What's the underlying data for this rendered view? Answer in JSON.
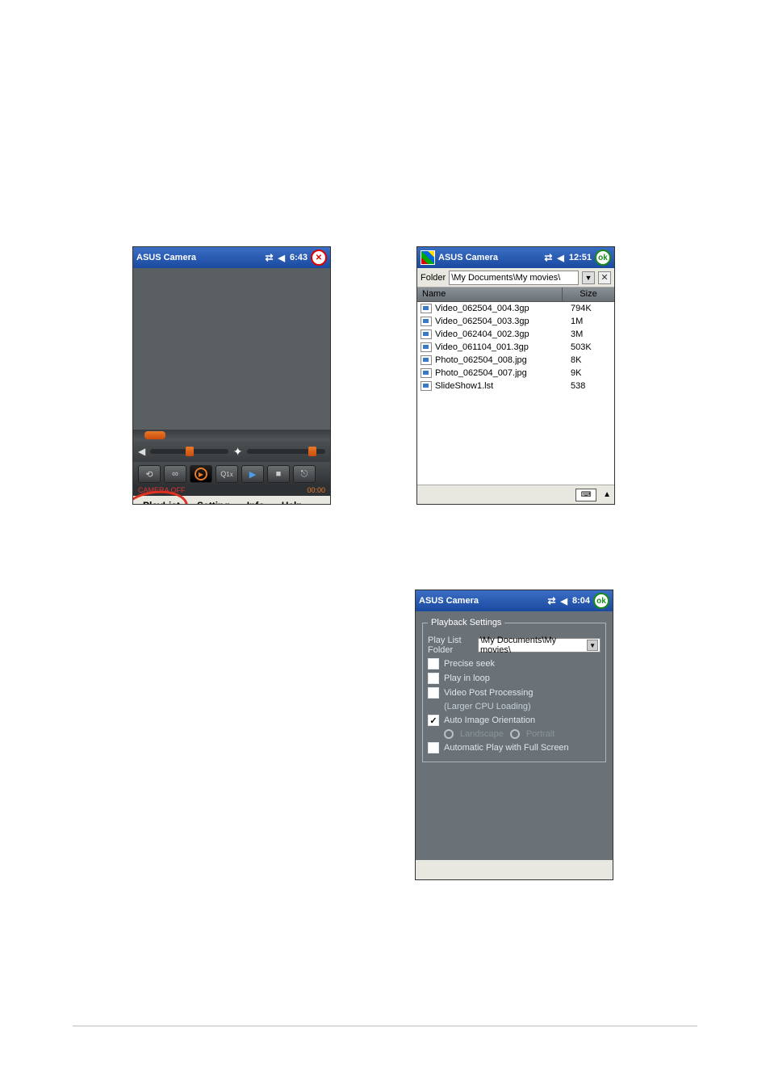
{
  "app_title": "ASUS Camera",
  "screen1": {
    "time": "6:43",
    "status_left": "CAMERA OFF",
    "status_right": "00:00",
    "zoom_label": "1x",
    "menu": {
      "playlist": "PlayList",
      "setting": "Setting",
      "info": "Info",
      "help": "Help"
    }
  },
  "screen2": {
    "time": "12:51",
    "folder_label": "Folder",
    "folder_path": "\\My Documents\\My movies\\",
    "columns": {
      "name": "Name",
      "size": "Size"
    },
    "files": [
      {
        "name": "Video_062504_004.3gp",
        "size": "794K"
      },
      {
        "name": "Video_062504_003.3gp",
        "size": "1M"
      },
      {
        "name": "Video_062404_002.3gp",
        "size": "3M"
      },
      {
        "name": "Video_061104_001.3gp",
        "size": "503K"
      },
      {
        "name": "Photo_062504_008.jpg",
        "size": "8K"
      },
      {
        "name": "Photo_062504_007.jpg",
        "size": "9K"
      },
      {
        "name": "SlideShow1.lst",
        "size": "538"
      }
    ]
  },
  "screen3": {
    "time": "8:04",
    "legend": "Playback Settings",
    "folder_label": "Play List Folder",
    "folder_path": "\\My Documents\\My movies\\",
    "options": {
      "precise_seek": {
        "label": "Precise seek",
        "checked": false
      },
      "play_in_loop": {
        "label": "Play in loop",
        "checked": false
      },
      "video_post": {
        "label": "Video Post Processing",
        "sublabel": "(Larger CPU Loading)",
        "checked": false
      },
      "auto_orient": {
        "label": "Auto Image Orientation",
        "checked": true
      },
      "landscape": "Landscape",
      "portrait": "Portrait",
      "auto_full": {
        "label": "Automatic Play with Full Screen",
        "checked": false
      }
    }
  }
}
